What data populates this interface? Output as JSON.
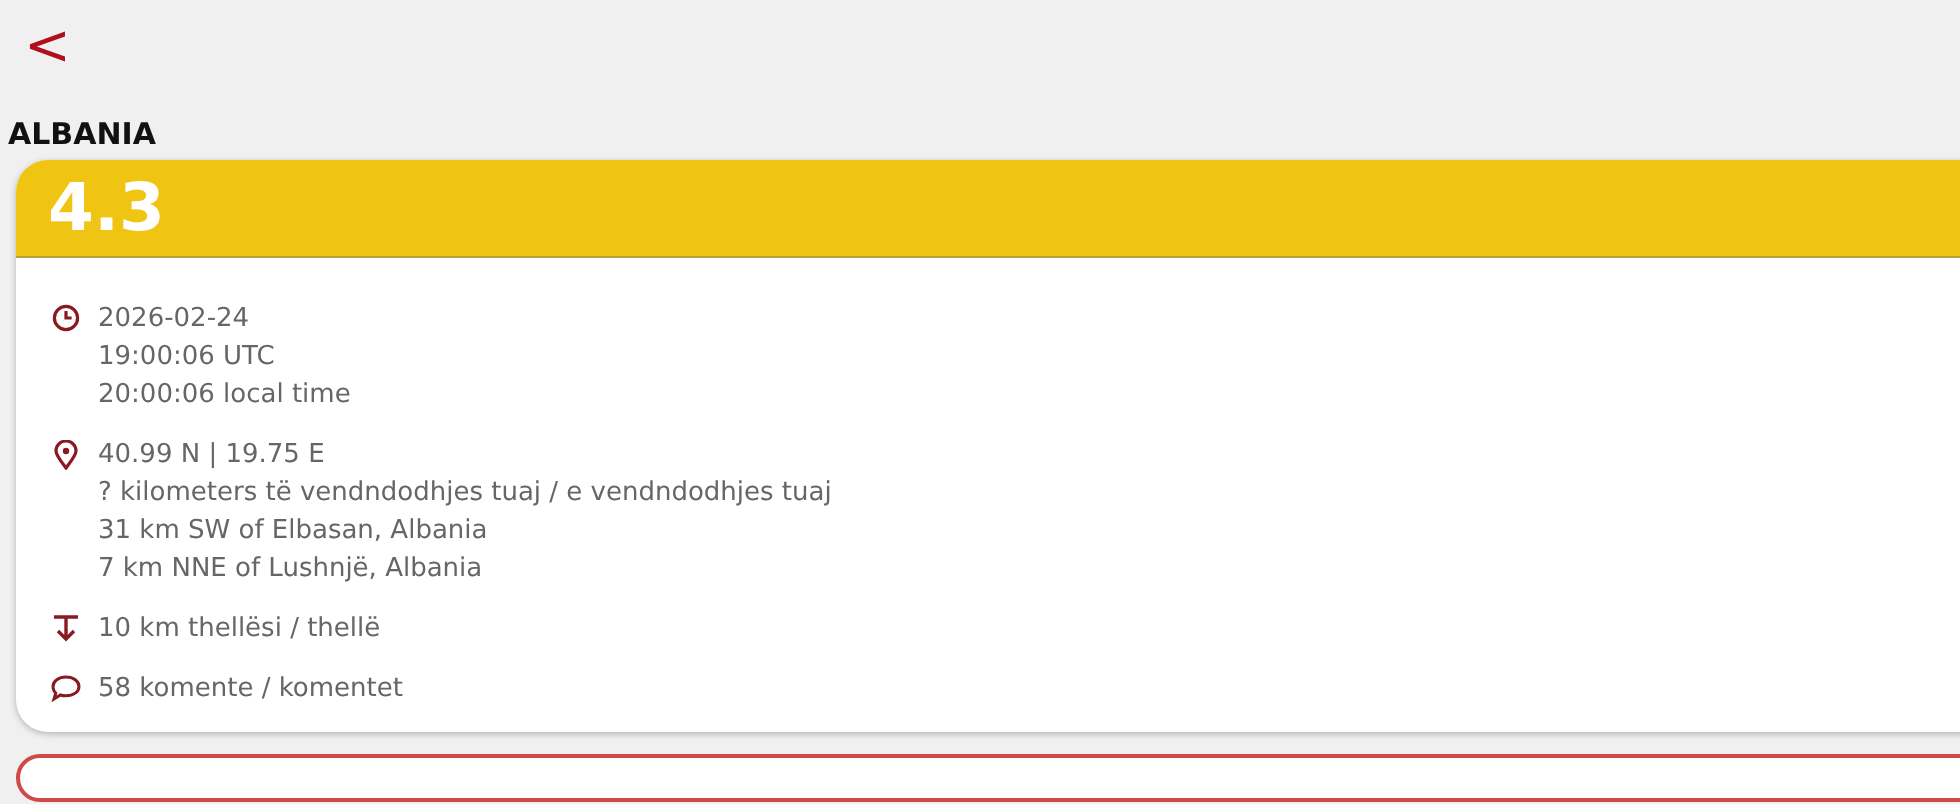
{
  "back": {
    "label": "<"
  },
  "region": "ALBANIA",
  "quake": {
    "magnitude": "4.3",
    "details": [
      {
        "kind": "time",
        "lines": [
          "2026-02-24",
          "19:00:06 UTC",
          "20:00:06 local time"
        ]
      },
      {
        "kind": "location",
        "lines": [
          "40.99 N | 19.75 E",
          "? kilometers të vendndodhjes tuaj / e vendndodhjes tuaj",
          "31 km SW of Elbasan, Albania",
          "7 km NNE of Lushnjë, Albania"
        ]
      },
      {
        "kind": "depth",
        "lines": [
          "10 km thellësi / thellë"
        ]
      },
      {
        "kind": "comments",
        "lines": [
          "58 komente / komentet"
        ]
      }
    ]
  }
}
